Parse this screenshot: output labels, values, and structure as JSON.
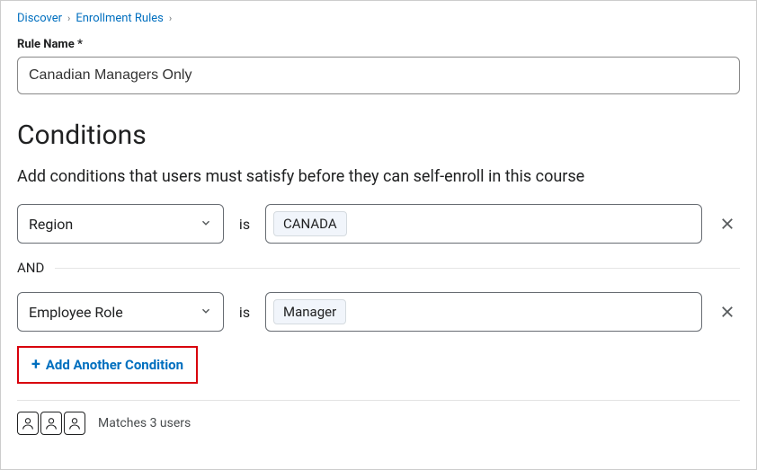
{
  "breadcrumb": {
    "items": [
      "Discover",
      "Enrollment Rules"
    ]
  },
  "ruleName": {
    "label": "Rule Name *",
    "value": "Canadian Managers Only"
  },
  "conditions": {
    "title": "Conditions",
    "description": "Add conditions that users must satisfy before they can self-enroll in this course",
    "isText": "is",
    "andText": "AND",
    "rows": [
      {
        "field": "Region",
        "value": "CANADA"
      },
      {
        "field": "Employee Role",
        "value": "Manager"
      }
    ],
    "addAnother": "Add Another Condition"
  },
  "matches": {
    "text": "Matches 3 users"
  }
}
